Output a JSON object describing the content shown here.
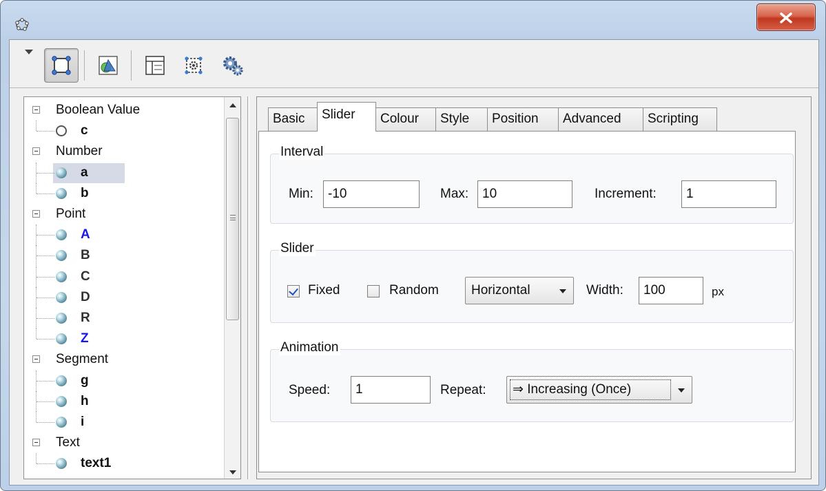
{
  "window": {
    "title": "",
    "close_glyph": "x"
  },
  "toolbar": {
    "buttons": [
      {
        "icon": "object-properties-icon",
        "active": true
      },
      {
        "icon": "graphics-properties-icon",
        "active": false
      },
      {
        "icon": "layout-icon",
        "active": false
      },
      {
        "icon": "preferences-icon",
        "active": false
      },
      {
        "icon": "advanced-settings-icon",
        "active": false
      }
    ]
  },
  "tree": {
    "items": [
      {
        "kind": "category",
        "label": "Boolean Value"
      },
      {
        "kind": "leaf",
        "label": "c",
        "icon": "ring",
        "color": "#111111"
      },
      {
        "kind": "category",
        "label": "Number"
      },
      {
        "kind": "leaf",
        "label": "a",
        "icon": "ball",
        "color": "#111111",
        "selected": true
      },
      {
        "kind": "leaf",
        "label": "b",
        "icon": "ball",
        "color": "#111111"
      },
      {
        "kind": "category",
        "label": "Point"
      },
      {
        "kind": "leaf",
        "label": "A",
        "icon": "ball",
        "color": "#1a18e8"
      },
      {
        "kind": "leaf",
        "label": "B",
        "icon": "ball",
        "color": "#333333"
      },
      {
        "kind": "leaf",
        "label": "C",
        "icon": "ball",
        "color": "#333333"
      },
      {
        "kind": "leaf",
        "label": "D",
        "icon": "ball",
        "color": "#333333"
      },
      {
        "kind": "leaf",
        "label": "R",
        "icon": "ball",
        "color": "#333333"
      },
      {
        "kind": "leaf",
        "label": "Z",
        "icon": "ball",
        "color": "#1a18e8"
      },
      {
        "kind": "category",
        "label": "Segment"
      },
      {
        "kind": "leaf",
        "label": "g",
        "icon": "ball",
        "color": "#111111"
      },
      {
        "kind": "leaf",
        "label": "h",
        "icon": "ball",
        "color": "#111111"
      },
      {
        "kind": "leaf",
        "label": "i",
        "icon": "ball",
        "color": "#111111"
      },
      {
        "kind": "category",
        "label": "Text"
      },
      {
        "kind": "leaf",
        "label": "text1",
        "icon": "ball",
        "color": "#111111"
      }
    ]
  },
  "tabs": [
    {
      "label": "Basic",
      "active": false
    },
    {
      "label": "Slider",
      "active": true
    },
    {
      "label": "Colour",
      "active": false
    },
    {
      "label": "Style",
      "active": false
    },
    {
      "label": "Position",
      "active": false
    },
    {
      "label": "Advanced",
      "active": false
    },
    {
      "label": "Scripting",
      "active": false
    }
  ],
  "interval": {
    "title": "Interval",
    "min_label": "Min:",
    "min_value": "-10",
    "max_label": "Max:",
    "max_value": "10",
    "increment_label": "Increment:",
    "increment_value": "1"
  },
  "slider": {
    "title": "Slider",
    "fixed_label": "Fixed",
    "fixed_checked": true,
    "random_label": "Random",
    "random_checked": false,
    "orientation": "Horizontal",
    "width_label": "Width:",
    "width_value": "100",
    "width_unit": "px"
  },
  "animation": {
    "title": "Animation",
    "speed_label": "Speed:",
    "speed_value": "1",
    "repeat_label": "Repeat:",
    "repeat_value": "⇒ Increasing (Once)"
  }
}
